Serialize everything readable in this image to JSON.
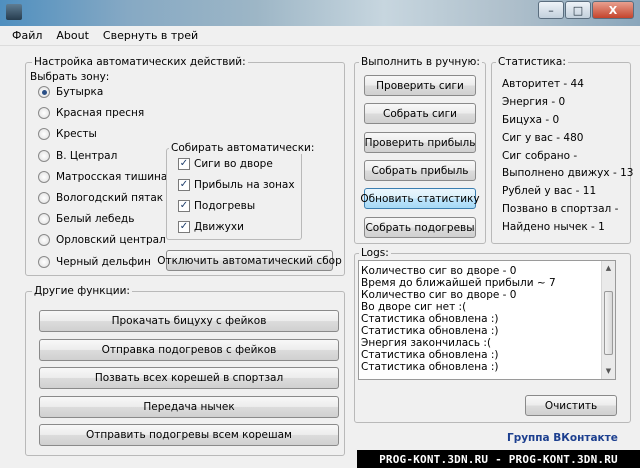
{
  "window": {
    "controls": {
      "minimize": "–",
      "maximize": "□",
      "close": "X"
    }
  },
  "menu": [
    "Файл",
    "About",
    "Свернуть в трей"
  ],
  "auto": {
    "group_title": "Настройка автоматических действий:",
    "zone_label": "Выбрать зону:",
    "zones": [
      "Бутырка",
      "Красная пресня",
      "Кресты",
      "В. Централ",
      "Матросская тишина",
      "Вологодский пятак",
      "Белый лебедь",
      "Орловский централ",
      "Черный дельфин"
    ],
    "selected_zone": "Бутырка",
    "collect_title": "Собирать автоматически:",
    "collect_items": [
      "Сиги во дворе",
      "Прибыль на зонах",
      "Подогревы",
      "Движухи"
    ],
    "disable_button": "Отключить автоматический сбор"
  },
  "other": {
    "group_title": "Другие функции:",
    "buttons": [
      "Прокачать бицуху с фейков",
      "Отправка подогревов с фейков",
      "Позвать всех корешей в спортзал",
      "Передача нычек",
      "Отправить подогревы всем корешам"
    ]
  },
  "manual": {
    "group_title": "Выполнить в ручную:",
    "buttons": [
      "Проверить сиги",
      "Собрать сиги",
      "Проверить прибыль",
      "Собрать прибыль",
      "Обновить статистику",
      "Собрать подогревы"
    ]
  },
  "stats": {
    "group_title": "Статистика:",
    "lines": [
      "Авторитет - 44",
      "Энергия - 0",
      "Бицуха - 0",
      "Сиг у вас - 480",
      "Сиг собрано -",
      "Выполнено движух - 13",
      "Рублей у вас - 11",
      "Позвано в спортзал -",
      "Найдено нычек - 1"
    ]
  },
  "logs": {
    "group_title": "Logs:",
    "lines": [
      "Количество сиг во дворе - 0",
      "Время до ближайшей прибыли ~ 7",
      "Количество сиг во дворе - 0",
      "Во дворе сиг нет :(",
      "Статистика обновлена :)",
      "Статистика обновлена :)",
      "Энергия закончилась :(",
      "Статистика обновлена :)",
      "Статистика обновлена :)"
    ],
    "clear_button": "Очистить"
  },
  "link": "Группа ВКонтакте",
  "watermark": "PROG-KONT.3DN.RU - PROG-KONT.3DN.RU",
  "colors": {
    "link": "#1c3f8f",
    "focused_button": "#3c7fb1"
  }
}
